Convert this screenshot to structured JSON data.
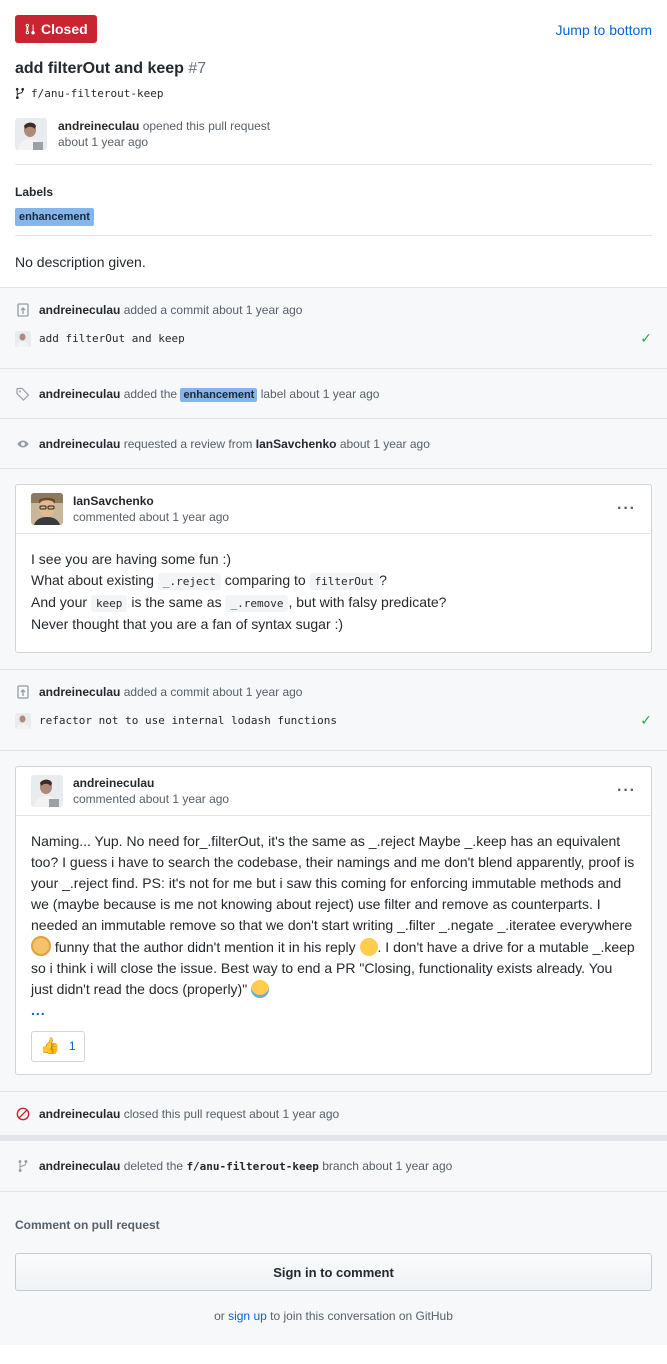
{
  "header": {
    "state": "Closed",
    "jump_label": "Jump to bottom",
    "title": "add filterOut and keep",
    "number": "#7",
    "branch": "f/anu-filterout-keep"
  },
  "opener": {
    "user": "andreineculau",
    "action": "opened this pull request",
    "time": "about 1 year ago"
  },
  "labels": {
    "heading": "Labels",
    "items": [
      "enhancement"
    ]
  },
  "description": "No description given.",
  "timeline": {
    "commit1": {
      "user": "andreineculau",
      "action": "added a commit about 1 year ago",
      "message": "add filterOut and keep"
    },
    "label_event": {
      "user": "andreineculau",
      "action": "added the",
      "label": "enhancement",
      "suffix": "label about 1 year ago"
    },
    "review_event": {
      "user": "andreineculau",
      "action": "requested a review from",
      "reviewer": "IanSavchenko",
      "suffix": "about 1 year ago"
    },
    "comment1": {
      "user": "IanSavchenko",
      "meta": "commented about 1 year ago",
      "line1": "I see you are having some fun :)",
      "line2_a": "What about existing",
      "line2_code1": "_.reject",
      "line2_b": "comparing to",
      "line2_code2": "filterOut",
      "line2_c": "?",
      "line3_a": "And your",
      "line3_code1": "keep",
      "line3_b": "is the same as",
      "line3_code2": "_.remove",
      "line3_c": ", but with falsy predicate?",
      "line4": "Never thought that you are a fan of syntax sugar :)"
    },
    "commit2": {
      "user": "andreineculau",
      "action": "added a commit about 1 year ago",
      "message": "refactor not to use internal lodash functions"
    },
    "comment2": {
      "user": "andreineculau",
      "meta": "commented about 1 year ago",
      "text_a": "Naming... Yup. No need for_.filterOut, it's the same as _.reject Maybe _.keep has an equivalent too? I guess i have to search the codebase, their namings and me don't blend apparently, proof is your _.reject find. PS: it's not for me but i saw this coming for enforcing immutable methods and we (maybe because is me not knowing about reject) use filter and remove as counterparts. I needed an immutable remove so that we don't start writing _.filter _.negate _.iteratee everywhere",
      "text_b": "funny that the author didn't mention it in his reply",
      "text_c": ". I don't have a drive for a mutable _.keep so i think i will close the issue. Best way to end a PR \"Closing, functionality exists already. You just didn't read the docs (properly)\"",
      "more": "...",
      "reaction_count": "1"
    },
    "closed_event": {
      "user": "andreineculau",
      "action": "closed this pull request about 1 year ago"
    },
    "deleted_event": {
      "user": "andreineculau",
      "action": "deleted the",
      "branch": "f/anu-filterout-keep",
      "suffix": "branch about 1 year ago"
    }
  },
  "footer": {
    "heading": "Comment on pull request",
    "signin_label": "Sign in to comment",
    "or": "or",
    "signup_link": "sign up",
    "signup_suffix": "to join this conversation on GitHub"
  },
  "colors": {
    "closed_red": "#cb2431",
    "link_blue": "#0366d6",
    "label_blue": "#84b6eb",
    "success_green": "#28a745"
  }
}
